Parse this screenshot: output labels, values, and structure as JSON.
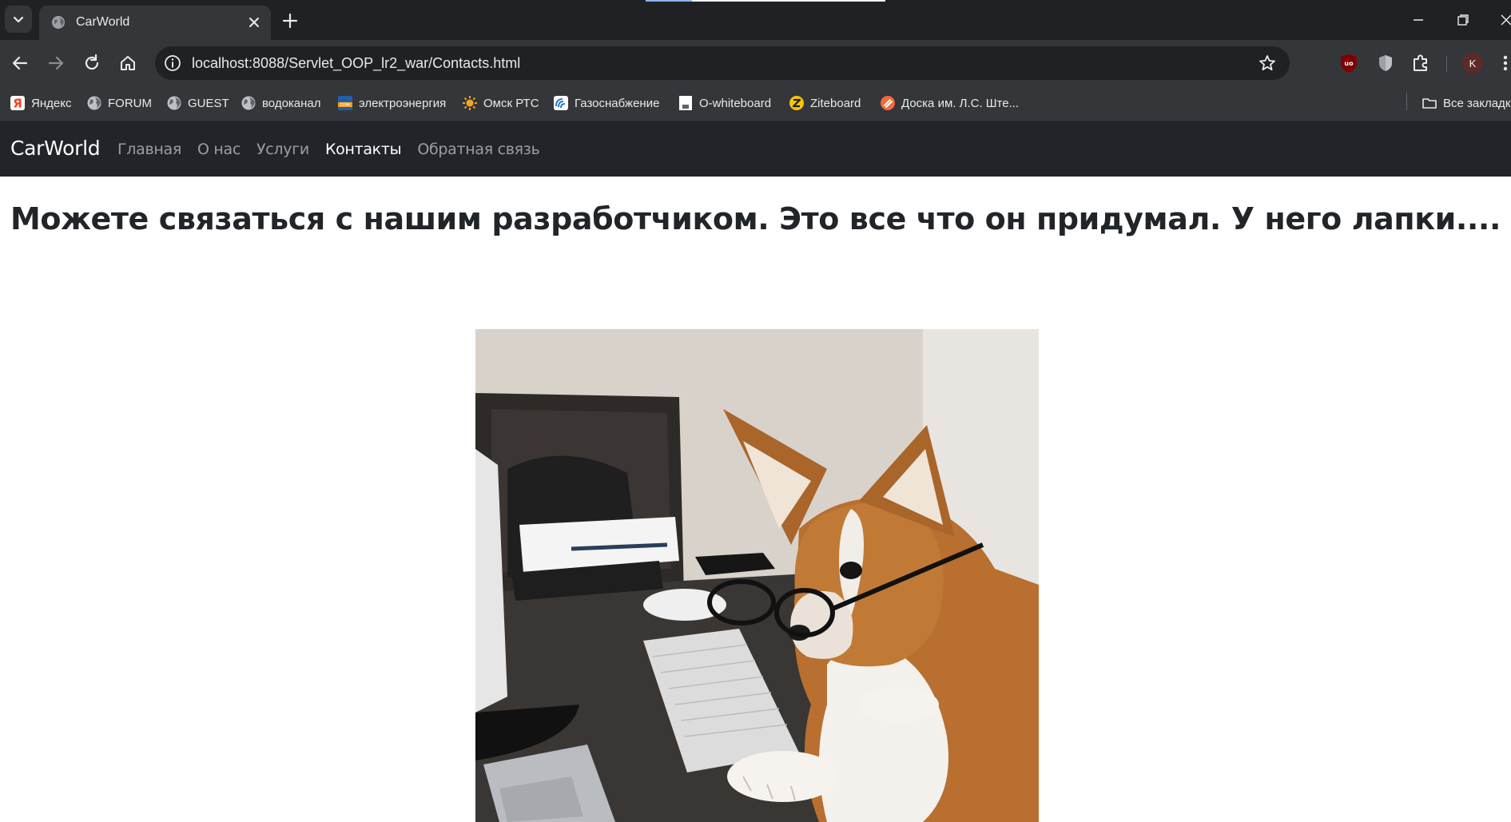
{
  "browser": {
    "tab": {
      "title": "CarWorld"
    },
    "address_bar": {
      "url": "localhost:8088/Servlet_OOP_lr2_war/Contacts.html"
    },
    "avatar_initial": "K",
    "bookmarks": [
      {
        "label": "Яндекс",
        "icon": "yandex-icon"
      },
      {
        "label": "FORUM",
        "icon": "globe-icon"
      },
      {
        "label": "GUEST",
        "icon": "globe-icon"
      },
      {
        "label": "водоканал",
        "icon": "globe-icon"
      },
      {
        "label": "электроэнергия",
        "icon": "energy-icon"
      },
      {
        "label": "Омск РТС",
        "icon": "sun-icon"
      },
      {
        "label": "Газоснабжение",
        "icon": "gas-icon"
      },
      {
        "label": "O-whiteboard",
        "icon": "whiteboard-icon"
      },
      {
        "label": "Ziteboard",
        "icon": "ziteboard-icon"
      },
      {
        "label": "Доска им. Л.С. Ште...",
        "icon": "board-icon"
      }
    ],
    "all_bookmarks_label": "Все закладки"
  },
  "site": {
    "brand": "CarWorld",
    "nav": [
      {
        "label": "Главная",
        "active": false
      },
      {
        "label": "О нас",
        "active": false
      },
      {
        "label": "Услуги",
        "active": false
      },
      {
        "label": "Контакты",
        "active": true
      },
      {
        "label": "Обратная связь",
        "active": false
      }
    ],
    "heading": "Можете связаться с нашим разработчиком. Это все что он придумал. У него лапки....",
    "image": {
      "subject": "corgi wearing glasses at a desk with keyboard"
    }
  },
  "colors": {
    "browser_frame": "#202124",
    "toolbar": "#35363a",
    "navbar": "#212529",
    "heading": "#212529"
  }
}
